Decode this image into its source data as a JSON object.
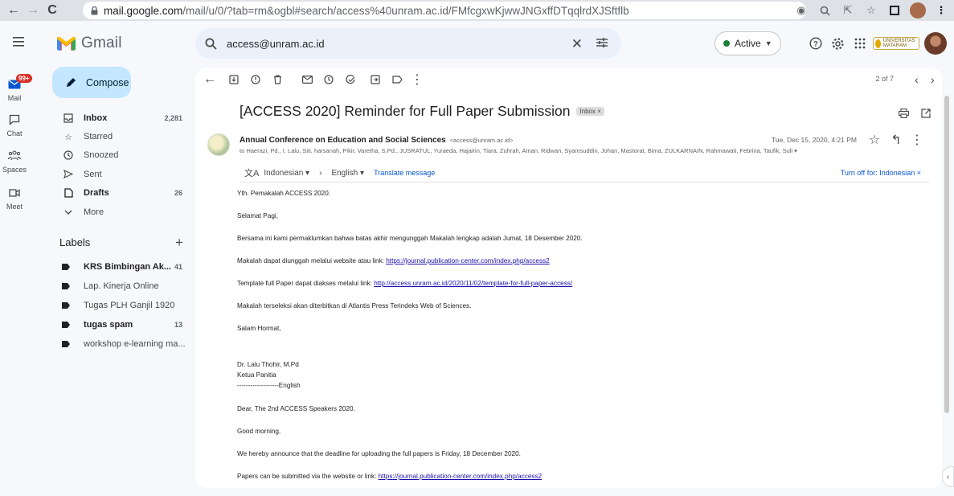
{
  "browser": {
    "url_host": "mail.google.com",
    "url_path": "/mail/u/0/?tab=rm&ogbl#search/access%40unram.ac.id/FMfcgxwKjwwJNGxffDTqqlrdXJSftflb"
  },
  "header": {
    "app_name": "Gmail",
    "search_query": "access@unram.ac.id",
    "status_label": "Active",
    "org_badge": "UNIVERSITAS MATARAM"
  },
  "rail": {
    "mail_label": "Mail",
    "mail_badge": "99+",
    "chat_label": "Chat",
    "spaces_label": "Spaces",
    "meet_label": "Meet"
  },
  "sidebar": {
    "compose_label": "Compose",
    "nav": [
      {
        "label": "Inbox",
        "count": "2,281",
        "bold": true,
        "icon": "inbox-icon"
      },
      {
        "label": "Starred",
        "count": "",
        "bold": false,
        "icon": "star-icon"
      },
      {
        "label": "Snoozed",
        "count": "",
        "bold": false,
        "icon": "clock-icon"
      },
      {
        "label": "Sent",
        "count": "",
        "bold": false,
        "icon": "send-icon"
      },
      {
        "label": "Drafts",
        "count": "26",
        "bold": true,
        "icon": "draft-icon"
      },
      {
        "label": "More",
        "count": "",
        "bold": false,
        "icon": "chevron-down-icon"
      }
    ],
    "labels_title": "Labels",
    "labels": [
      {
        "label": "KRS Bimbingan Ak...",
        "count": "41",
        "bold": true
      },
      {
        "label": "Lap. Kinerja Online",
        "count": "",
        "bold": false
      },
      {
        "label": "Tugas PLH Ganjil 1920",
        "count": "",
        "bold": false
      },
      {
        "label": "tugas spam",
        "count": "13",
        "bold": true
      },
      {
        "label": "workshop e-learning ma...",
        "count": "",
        "bold": false
      }
    ]
  },
  "toolbar": {
    "pager": "2 of 7"
  },
  "message": {
    "subject": "[ACCESS 2020] Reminder for Full Paper Submission",
    "chip": "Inbox",
    "sender_name": "Annual Conference on Education and Social Sciences",
    "sender_email": "<access@unram.ac.id>",
    "recipients": "to Haerazi, Pd., I, Lalu, Siti, harsanah, Pikir, Varetha, S.Pd., JUSRATUL, Yuraeda, Hajairin, Tiara, Zuhrah, Aman, Ridwan, Syamsuddin, Johan, Mastorat, Bima, ZULKARNAIN, Rahmawati, Febrina, Taufik, Suli",
    "date": "Tue, Dec 15, 2020, 4:21 PM",
    "translate": {
      "from": "Indonesian",
      "to": "English",
      "link": "Translate message",
      "off": "Turn off for: Indonesian"
    },
    "body": {
      "greeting": "Yth. Pemakalah ACCESS 2020.",
      "salam": "Selamat Pagi,",
      "p1": "Bersama ini kami permaklumkan bahwa batas akhir mengunggah Makalah lengkap adalah Jumat, 18 Desember 2020.",
      "p2_text": "Makalah dapat diunggah melalui website atau link: ",
      "p2_link": "https://journal.publication-center.com/index.php/access2",
      "p3_text": "Template full Paper dapat diakses melalui link: ",
      "p3_link": "http://access.unram.ac.id/2020/11/02/template-for-full-paper-access/",
      "p4": "Makalah terseleksi akan diterbitkan di Atlantis Press Terindeks Web of Sciences.",
      "closing": "Salam Hormat,",
      "sig_name": "Dr. Lalu Thohir, M.Pd",
      "sig_title": "Ketua Panitia",
      "divider": "-------------------English",
      "en_greeting": "Dear, The 2nd ACCESS Speakers 2020.",
      "en_morning": "Good morning,",
      "en_p1": "We hereby announce that the deadline for uploading the full papers is Friday, 18 December 2020.",
      "en_p2_text": "Papers can be submitted via the website or link: ",
      "en_p2_link": "https://journal.publication-center.com/index.php/access2"
    }
  }
}
